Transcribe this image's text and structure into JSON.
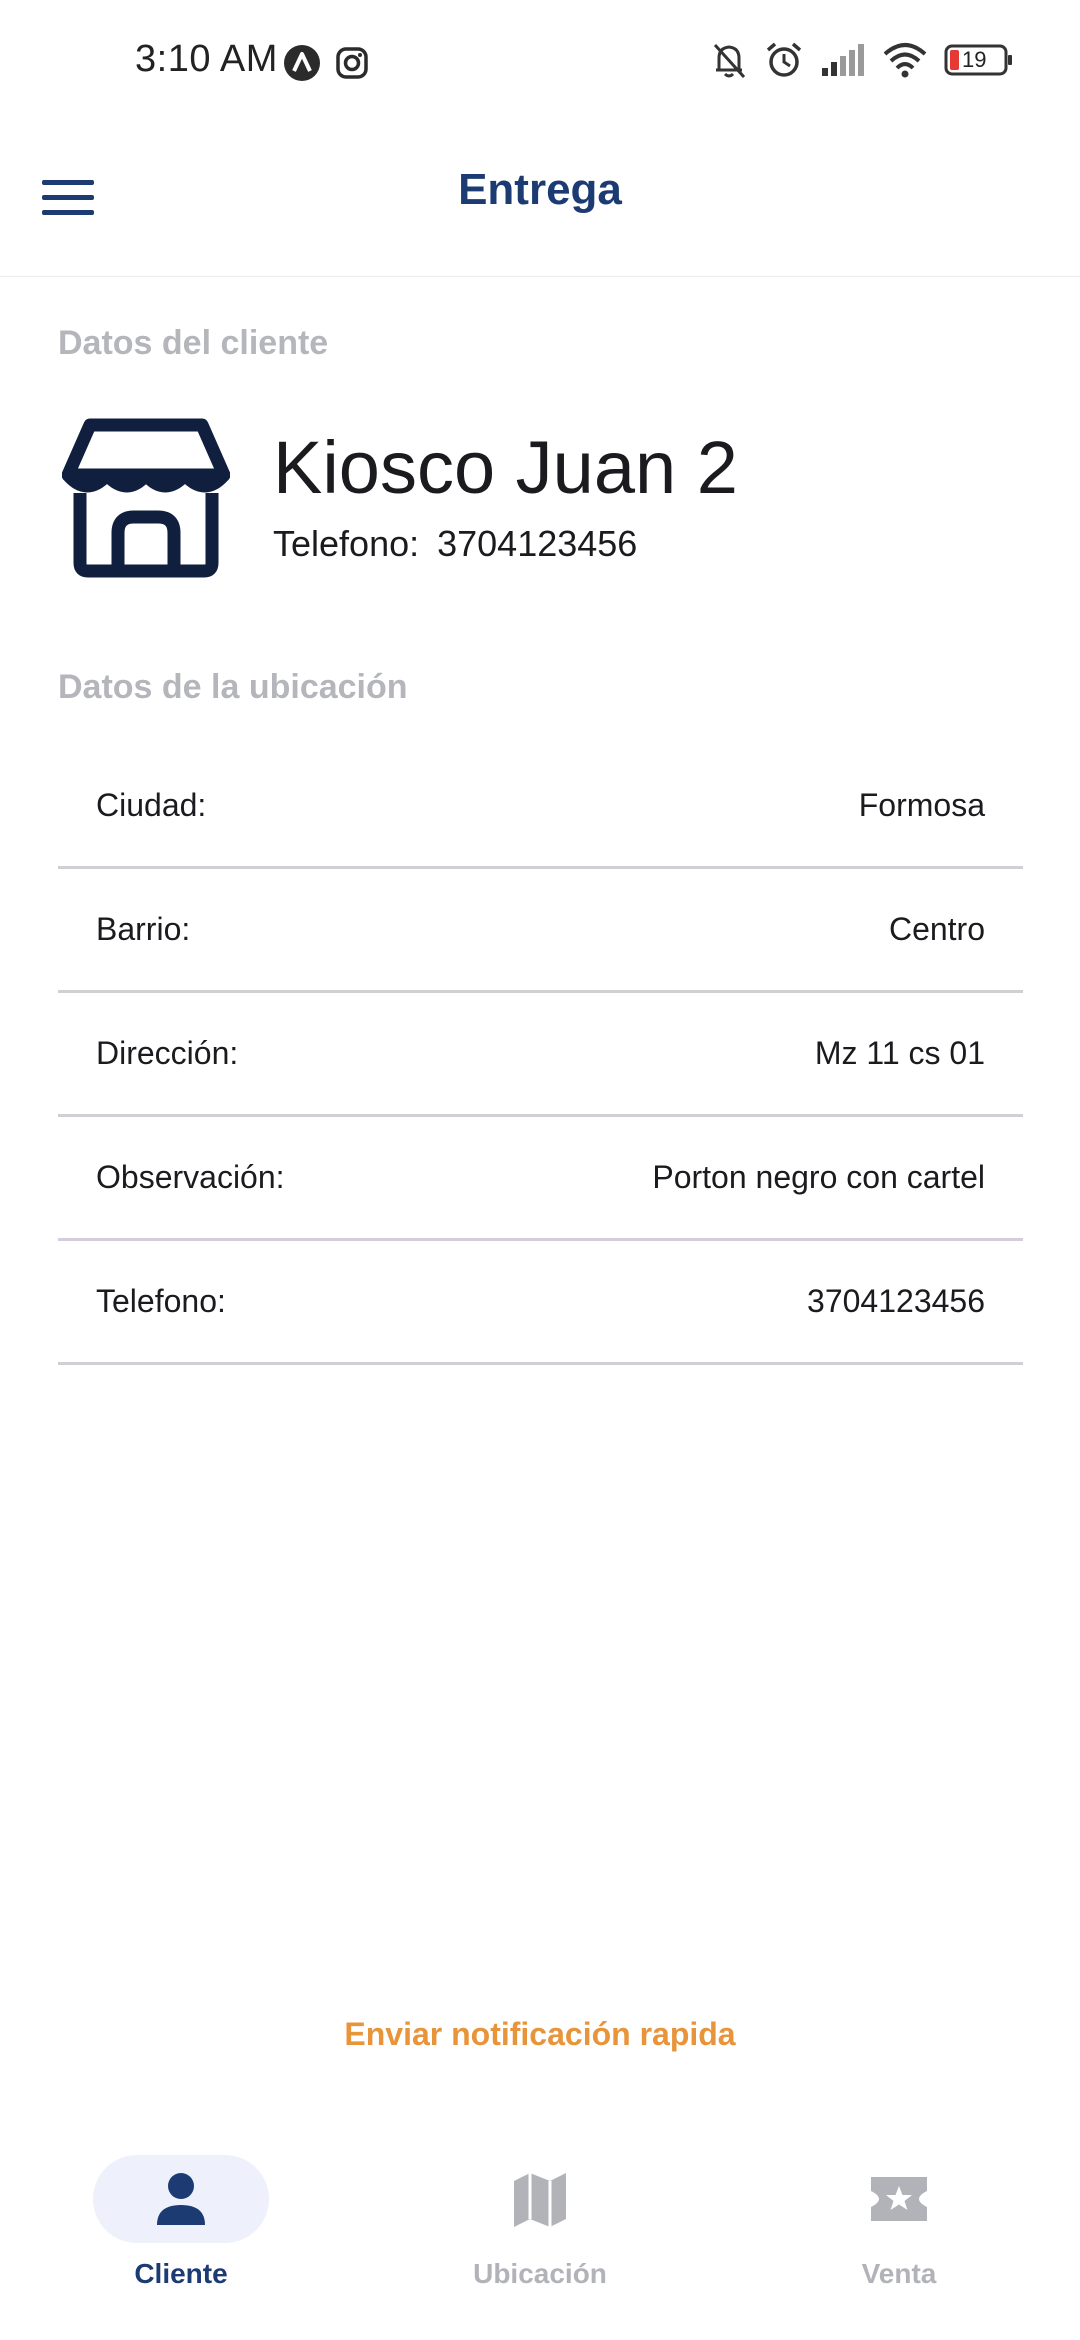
{
  "status_bar": {
    "time": "3:10 AM",
    "battery": "19"
  },
  "app_bar": {
    "title": "Entrega"
  },
  "client_section": {
    "title": "Datos del cliente",
    "name": "Kiosco Juan 2",
    "phone_label": "Telefono:",
    "phone_value": "3704123456"
  },
  "location_section": {
    "title": "Datos de la ubicación",
    "rows": [
      {
        "label": "Ciudad:",
        "value": "Formosa"
      },
      {
        "label": "Barrio:",
        "value": "Centro"
      },
      {
        "label": "Dirección:",
        "value": "Mz 11 cs 01"
      },
      {
        "label": "Observación:",
        "value": "Porton negro con cartel"
      },
      {
        "label": "Telefono:",
        "value": "3704123456"
      }
    ]
  },
  "actions": {
    "notify_label": "Enviar notificación rapida"
  },
  "bottom_nav": {
    "items": [
      {
        "label": "Cliente",
        "icon": "person-icon",
        "active": true
      },
      {
        "label": "Ubicación",
        "icon": "map-icon",
        "active": false
      },
      {
        "label": "Venta",
        "icon": "ticket-star-icon",
        "active": false
      }
    ]
  },
  "colors": {
    "primary": "#1d3b73",
    "muted": "#b5b6bb",
    "accent": "#e8943a",
    "divider": "#cfd0d4"
  }
}
